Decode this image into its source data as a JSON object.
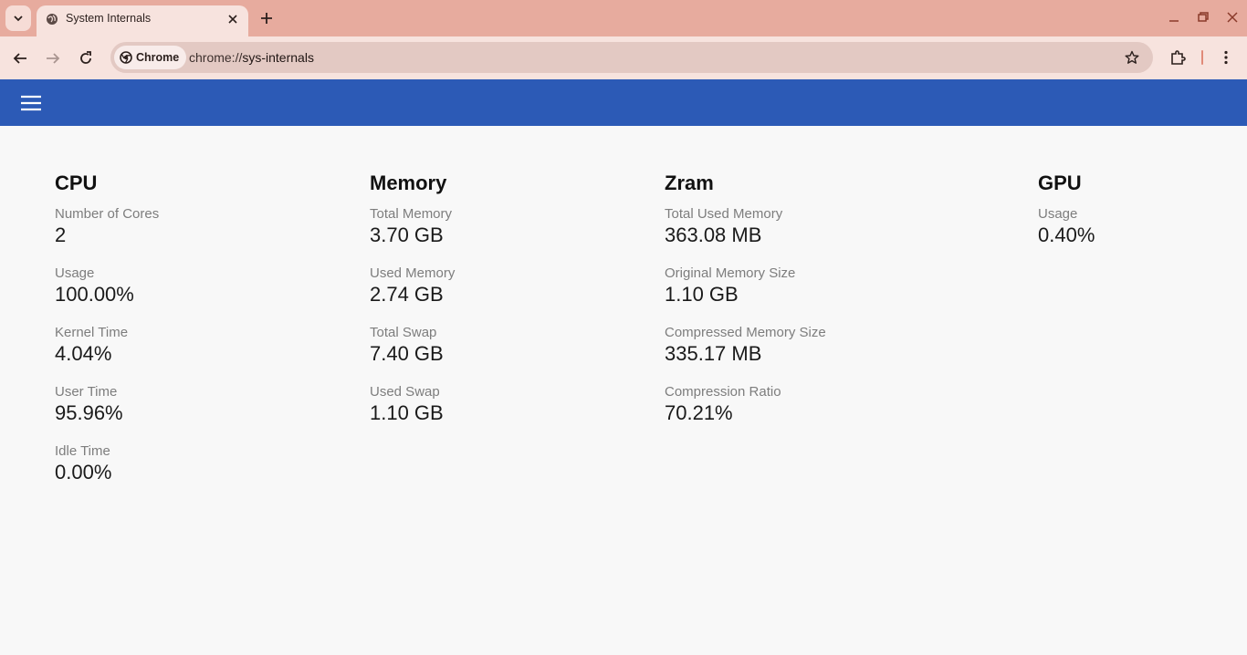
{
  "browser": {
    "tab_title": "System Internals",
    "chip_label": "Chrome",
    "url_scheme": "chrome://",
    "url_host": "sys-internals"
  },
  "sections": {
    "cpu": {
      "title": "CPU",
      "items": [
        {
          "label": "Number of Cores",
          "value": "2"
        },
        {
          "label": "Usage",
          "value": "100.00%"
        },
        {
          "label": "Kernel Time",
          "value": "4.04%"
        },
        {
          "label": "User Time",
          "value": "95.96%"
        },
        {
          "label": "Idle Time",
          "value": "0.00%"
        }
      ]
    },
    "memory": {
      "title": "Memory",
      "items": [
        {
          "label": "Total Memory",
          "value": "3.70 GB"
        },
        {
          "label": "Used Memory",
          "value": "2.74 GB"
        },
        {
          "label": "Total Swap",
          "value": "7.40 GB"
        },
        {
          "label": "Used Swap",
          "value": "1.10 GB"
        }
      ]
    },
    "zram": {
      "title": "Zram",
      "items": [
        {
          "label": "Total Used Memory",
          "value": "363.08 MB"
        },
        {
          "label": "Original Memory Size",
          "value": "1.10 GB"
        },
        {
          "label": "Compressed Memory Size",
          "value": "335.17 MB"
        },
        {
          "label": "Compression Ratio",
          "value": "70.21%"
        }
      ]
    },
    "gpu": {
      "title": "GPU",
      "items": [
        {
          "label": "Usage",
          "value": "0.40%"
        }
      ]
    }
  },
  "colors": {
    "tabstrip": "#e7ab9e",
    "toolbar": "#f7e3de",
    "appbar": "#2c5ab6"
  }
}
